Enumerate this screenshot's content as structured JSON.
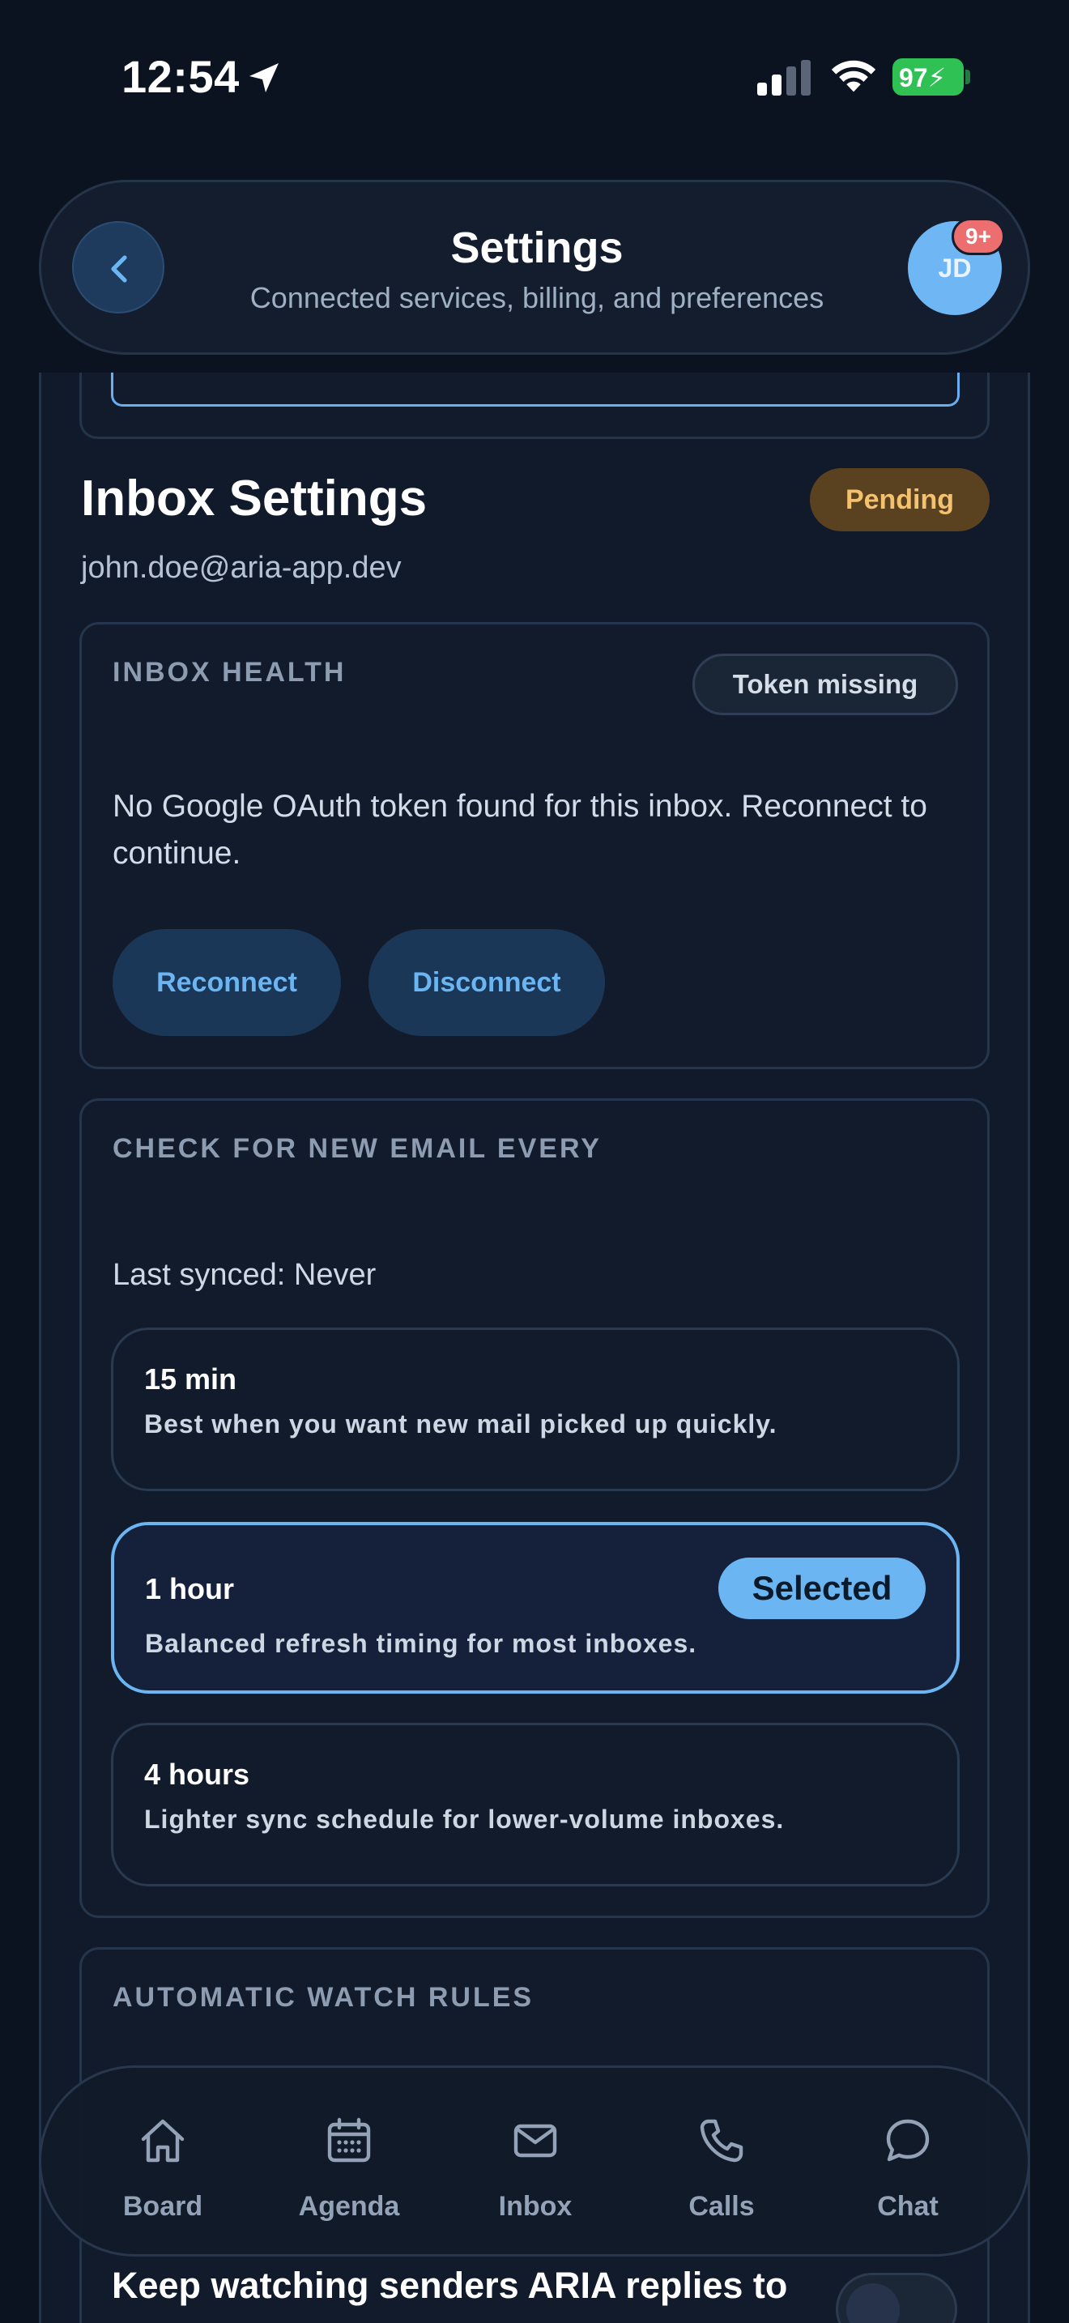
{
  "status_bar": {
    "time": "12:54",
    "battery": "97"
  },
  "header": {
    "title": "Settings",
    "subtitle": "Connected services, billing, and preferences",
    "avatar_initials": "JD",
    "notification_badge": "9+"
  },
  "inbox": {
    "title": "Inbox Settings",
    "status_badge": "Pending",
    "email": "john.doe@aria-app.dev"
  },
  "health": {
    "label": "INBOX HEALTH",
    "token_status": "Token missing",
    "message": "No Google OAuth token found for this inbox. Reconnect to continue.",
    "reconnect_label": "Reconnect",
    "disconnect_label": "Disconnect"
  },
  "sync": {
    "label": "CHECK FOR NEW EMAIL EVERY",
    "last_synced": "Last synced: Never",
    "selected_label": "Selected",
    "options": [
      {
        "title": "15 min",
        "desc": "Best when you want new mail picked up quickly.",
        "selected": false
      },
      {
        "title": "1 hour",
        "desc": "Balanced refresh timing for most inboxes.",
        "selected": true
      },
      {
        "title": "4 hours",
        "desc": "Lighter sync schedule for lower-volume inboxes.",
        "selected": false
      }
    ]
  },
  "watch_rules": {
    "label": "AUTOMATIC WATCH RULES",
    "keep_watching_label": "Keep watching senders ARIA replies to",
    "keep_watching_on": false
  },
  "nav": {
    "items": [
      {
        "label": "Board",
        "icon": "home-icon"
      },
      {
        "label": "Agenda",
        "icon": "calendar-icon"
      },
      {
        "label": "Inbox",
        "icon": "mail-icon"
      },
      {
        "label": "Calls",
        "icon": "phone-icon"
      },
      {
        "label": "Chat",
        "icon": "chat-bubble-icon"
      }
    ]
  },
  "colors": {
    "background": "#0b1320",
    "card": "#111b2b",
    "accent": "#6ab5f2",
    "pending_bg": "#5a4220",
    "pending_text": "#f4c16e",
    "badge_red": "#ec6e6e",
    "battery_green": "#2fc153"
  }
}
